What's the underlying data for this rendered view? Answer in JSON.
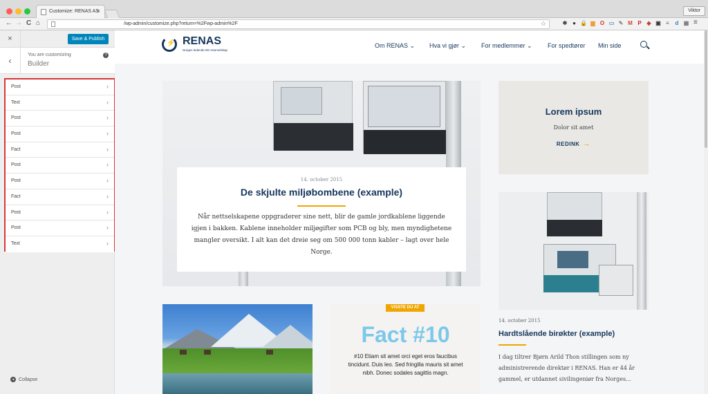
{
  "browser": {
    "tab_title": "Customize: RENAS AS",
    "tab_close": "×",
    "profile": "Viktor",
    "url": "/wp-admin/customize.php?return=%2Fwp-admin%2F",
    "nav": {
      "back": "←",
      "forward": "→",
      "reload": "C",
      "home": "⌂"
    },
    "star": "☆",
    "menu": "≡",
    "extensions": [
      {
        "icon": "gear-extension-icon",
        "glyph": "✱",
        "color": "#444444"
      },
      {
        "icon": "circle-extension-icon",
        "glyph": "●",
        "color": "#333333"
      },
      {
        "icon": "lock-extension-icon",
        "glyph": "🔒",
        "color": "#d08a1a"
      },
      {
        "icon": "folder-extension-icon",
        "glyph": "▆",
        "color": "#e9a23b"
      },
      {
        "icon": "opera-extension-icon",
        "glyph": "O",
        "color": "#e0301e"
      },
      {
        "icon": "pocket-extension-icon",
        "glyph": "▭",
        "color": "#5a8ecb"
      },
      {
        "icon": "puzzle-extension-icon",
        "glyph": "✎",
        "color": "#8a8a8a"
      },
      {
        "icon": "mail-extension-icon",
        "glyph": "M",
        "color": "#d44638"
      },
      {
        "icon": "pinterest-extension-icon",
        "glyph": "P",
        "color": "#cb2027"
      },
      {
        "icon": "shield-extension-icon",
        "glyph": "◈",
        "color": "#c0392b"
      },
      {
        "icon": "box-extension-icon",
        "glyph": "▣",
        "color": "#3a3a3a"
      },
      {
        "icon": "list-extension-icon",
        "glyph": "≡",
        "color": "#6a6a6a"
      },
      {
        "icon": "d-extension-icon",
        "glyph": "d",
        "color": "#2e86c1"
      },
      {
        "icon": "grid-extension-icon",
        "glyph": "▦",
        "color": "#777777"
      }
    ]
  },
  "customizer": {
    "close": "×",
    "save_label": "Save & Publish",
    "back": "‹",
    "customizing_label": "You are customizing",
    "panel_title": "Builder",
    "help": "?",
    "sections": [
      "Post",
      "Text",
      "Post",
      "Post",
      "Fact",
      "Post",
      "Post",
      "Fact",
      "Post",
      "Post",
      "Text"
    ],
    "chevron": "›",
    "collapse_label": "Collapse",
    "collapse_icon": "◂",
    "accent_color": "#0085ba",
    "highlight_color": "#d63638"
  },
  "site": {
    "logo_name": "RENAS",
    "logo_tagline": "Norges ledende EE-returselskap",
    "nav": [
      {
        "label": "Om RENAS",
        "dropdown": "⌄"
      },
      {
        "label": "Hva vi gjør",
        "dropdown": "⌄"
      },
      {
        "label": "For medlemmer",
        "dropdown": "⌄"
      },
      {
        "label": "For spedtører",
        "dropdown": ""
      },
      {
        "label": "Min side",
        "dropdown": ""
      }
    ],
    "brand_color": "#16365c",
    "accent_color": "#f0a500"
  },
  "hero": {
    "date": "14. october 2015",
    "title": "De skjulte miljøbombene (example)",
    "text": "Når nettselskapene oppgraderer sine nett, blir de gamle jordkablene liggende igjen i bakken. Kablene inneholder miljøgifter som PCB og bly, men myndighetene mangler oversikt. I alt kan det dreie seg om 500 000 tonn kabler – lagt over hele Norge."
  },
  "promo": {
    "title": "Lorem ipsum",
    "subtitle": "Dolor sit amet",
    "link": "REDINK",
    "arrow": "→"
  },
  "side_post": {
    "date": "14. october 2015",
    "title": "Hardtslående birøkter (example)",
    "text": "I dag tiltrer Bjørn Arild Thon stillingen som ny administrerende direktør i RENAS. Han er 44 år gammel, er utdannet sivilingeniør fra Norges..."
  },
  "fact": {
    "badge": "VISSTE DU AT",
    "title": "Fact #10",
    "text": "#10 Etiam sit amet orci eget eros faucibus tincidunt. Duis leo. Sed fringilla mauris sit amet nibh. Donec sodales sagittis magn.",
    "title_color": "#7cc8ea"
  }
}
